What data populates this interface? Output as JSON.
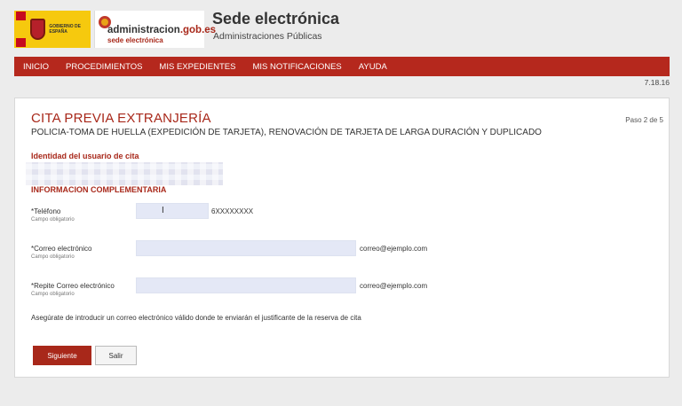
{
  "header": {
    "gob_logo_text": "GOBIERNO DE ESPAÑA",
    "admin_logo": {
      "main": "administracion",
      "domain": ".gob.es",
      "sub": "sede electrónica"
    },
    "title": "Sede electrónica",
    "subtitle": "Administraciones Públicas"
  },
  "nav": {
    "items": [
      {
        "label": "INICIO"
      },
      {
        "label": "PROCEDIMIENTOS"
      },
      {
        "label": "MIS EXPEDIENTES"
      },
      {
        "label": "MIS NOTIFICACIONES"
      },
      {
        "label": "AYUDA"
      }
    ]
  },
  "version": "7.18.16",
  "form": {
    "step": "Paso 2 de 5",
    "title": "CITA PREVIA EXTRANJERÍA",
    "subtitle": "POLICIA-TOMA DE HUELLA (EXPEDICIÓN DE TARJETA), RENOVACIÓN DE TARJETA DE LARGA DURACIÓN Y DUPLICADO",
    "identity_heading": "Identidad del usuario de cita",
    "section_heading": "INFORMACION COMPLEMENTARIA",
    "fields": [
      {
        "label": "*Teléfono",
        "required_note": "Campo obligatorio",
        "value": "",
        "hint": "6XXXXXXXX"
      },
      {
        "label": "*Correo electrónico",
        "required_note": "Campo obligatorio",
        "value": "",
        "hint": "correo@ejemplo.com"
      },
      {
        "label": "*Repite Correo electrónico",
        "required_note": "Campo obligatorio",
        "value": "",
        "hint": "correo@ejemplo.com"
      }
    ],
    "note": "Asegúrate de introducir un correo electrónico válido donde te enviarán el justificante de la reserva de cita",
    "next_label": "Siguiente",
    "exit_label": "Salir"
  },
  "colors": {
    "brand_red": "#b5281d",
    "heading_red": "#a8281a",
    "input_bg": "#e4e8f6"
  }
}
